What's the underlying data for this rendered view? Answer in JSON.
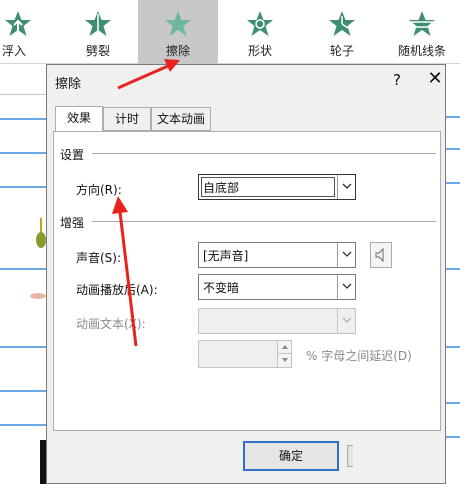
{
  "ribbon": {
    "items": [
      {
        "label": "浮入",
        "icon": "float-in-star-icon"
      },
      {
        "label": "劈裂",
        "icon": "split-star-icon"
      },
      {
        "label": "擦除",
        "icon": "wipe-star-icon"
      },
      {
        "label": "形状",
        "icon": "shape-star-icon"
      },
      {
        "label": "轮子",
        "icon": "wheel-star-icon"
      },
      {
        "label": "随机线条",
        "icon": "random-bars-star-icon"
      }
    ],
    "active_index": 2,
    "star_color": "#3e8f70"
  },
  "dialog": {
    "title": "擦除",
    "help": "?",
    "close": "✕",
    "tabs": [
      "效果",
      "计时",
      "文本动画"
    ],
    "settings_header": "设置",
    "direction_label": "方向(R):",
    "direction_value": "自底部",
    "enhance_header": "增强",
    "sound_label": "声音(S):",
    "sound_value": "[无声音]",
    "after_label": "动画播放后(A):",
    "after_value": "不变暗",
    "text_anim_label": "动画文本(X):",
    "text_anim_value": "",
    "delay_suffix": "% 字母之间延迟(D)",
    "ok_label": "确定"
  },
  "annotation_color": "#e8231d"
}
